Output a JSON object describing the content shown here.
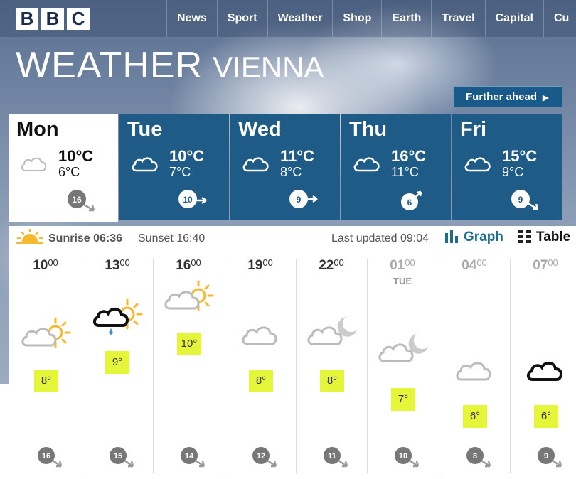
{
  "nav": {
    "logo": [
      "B",
      "B",
      "C"
    ],
    "items": [
      "News",
      "Sport",
      "Weather",
      "Shop",
      "Earth",
      "Travel",
      "Capital",
      "Cu"
    ]
  },
  "title": {
    "main": "WEATHER",
    "city": "VIENNA"
  },
  "further_ahead": "Further ahead",
  "colors": {
    "tab": "#1e5b87",
    "temp_badge": "#e4f53a",
    "accent": "#1a6e8e"
  },
  "days": [
    {
      "name": "Mon",
      "high": "10°C",
      "low": "6°C",
      "wind": "16",
      "icon": "cloud-icon"
    },
    {
      "name": "Tue",
      "high": "10°C",
      "low": "7°C",
      "wind": "10",
      "icon": "cloud-icon"
    },
    {
      "name": "Wed",
      "high": "11°C",
      "low": "8°C",
      "wind": "9",
      "icon": "cloud-icon"
    },
    {
      "name": "Thu",
      "high": "16°C",
      "low": "11°C",
      "wind": "6",
      "icon": "cloud-icon"
    },
    {
      "name": "Fri",
      "high": "15°C",
      "low": "9°C",
      "wind": "9",
      "icon": "cloud-icon"
    }
  ],
  "info": {
    "sunrise": "Sunrise 06:36",
    "sunset": "Sunset 16:40",
    "updated": "Last updated 09:04",
    "graph": "Graph",
    "table": "Table"
  },
  "hours": [
    {
      "h": "10",
      "m": "00",
      "temp": "8°",
      "wind": "16",
      "icon": "sun-cloud-icon"
    },
    {
      "h": "13",
      "m": "00",
      "temp": "9°",
      "wind": "15",
      "icon": "sun-rain-cloud-icon"
    },
    {
      "h": "16",
      "m": "00",
      "temp": "10°",
      "wind": "14",
      "icon": "sun-cloud-icon"
    },
    {
      "h": "19",
      "m": "00",
      "temp": "8°",
      "wind": "12",
      "icon": "cloud-icon"
    },
    {
      "h": "22",
      "m": "00",
      "temp": "8°",
      "wind": "11",
      "icon": "moon-cloud-icon"
    },
    {
      "h": "01",
      "m": "00",
      "temp": "7°",
      "wind": "10",
      "icon": "moon-cloud-icon",
      "day": "TUE"
    },
    {
      "h": "04",
      "m": "00",
      "temp": "6°",
      "wind": "8",
      "icon": "cloud-icon"
    },
    {
      "h": "07",
      "m": "00",
      "temp": "6°",
      "wind": "9",
      "icon": "black-cloud-icon"
    }
  ]
}
